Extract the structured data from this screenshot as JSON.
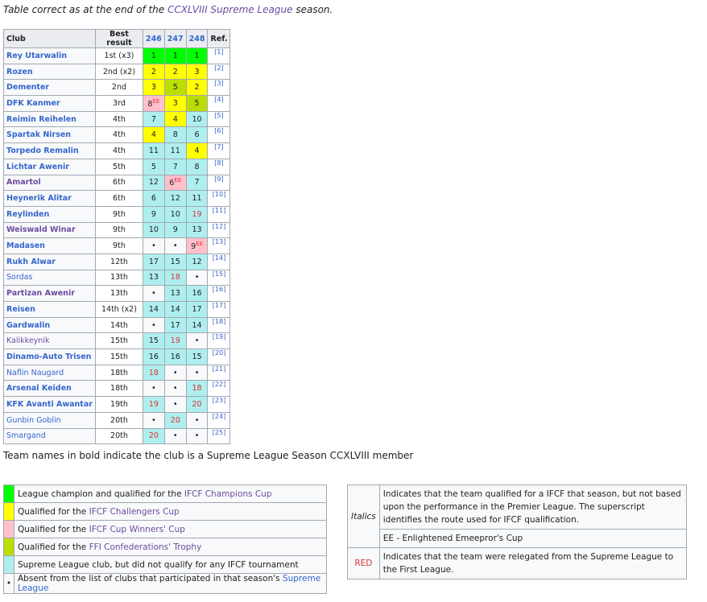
{
  "intro": {
    "before": "Table correct as at the end of the ",
    "link": "CCXLVIII Supreme League",
    "after": " season."
  },
  "headers": {
    "club": "Club",
    "best": "Best result",
    "y1": "246",
    "y2": "247",
    "y3": "248",
    "ref": "Ref."
  },
  "rows": [
    {
      "club": "Rey Utarwalin",
      "best": "1st (x3)",
      "r": [
        "1",
        "1",
        "1"
      ],
      "ref": "[1]"
    },
    {
      "club": "Rozen",
      "best": "2nd (x2)",
      "r": [
        "2",
        "2",
        "3"
      ],
      "ref": "[2]"
    },
    {
      "club": "Dementer",
      "best": "2nd",
      "r": [
        "3",
        "5",
        "2"
      ],
      "ref": "[3]"
    },
    {
      "club": "DFK Kanmer",
      "best": "3rd",
      "r": [
        "8",
        "3",
        "5"
      ],
      "r_sup": [
        "EE",
        "",
        ""
      ],
      "ref": "[4]"
    },
    {
      "club": "Reimin Reihelen",
      "best": "4th",
      "r": [
        "7",
        "4",
        "10"
      ],
      "ref": "[5]"
    },
    {
      "club": "Spartak Nirsen",
      "best": "4th",
      "r": [
        "4",
        "8",
        "6"
      ],
      "ref": "[6]"
    },
    {
      "club": "Torpedo Remalin",
      "best": "4th",
      "r": [
        "11",
        "11",
        "4"
      ],
      "ref": "[7]"
    },
    {
      "club": "Lichtar Awenir",
      "best": "5th",
      "r": [
        "5",
        "7",
        "8"
      ],
      "ref": "[8]"
    },
    {
      "club": "Amartol",
      "best": "6th",
      "r": [
        "12",
        "6",
        "7"
      ],
      "r_sup": [
        "",
        "EE",
        ""
      ],
      "ref": "[9]"
    },
    {
      "club": "Heynerik Alitar",
      "best": "6th",
      "r": [
        "6",
        "12",
        "11"
      ],
      "ref": "[10]"
    },
    {
      "club": "Reylinden",
      "best": "9th",
      "r": [
        "9",
        "10",
        "19"
      ],
      "ref": "[11]"
    },
    {
      "club": "Weiswald Winar",
      "best": "9th",
      "r": [
        "10",
        "9",
        "13"
      ],
      "ref": "[12]"
    },
    {
      "club": "Madasen",
      "best": "9th",
      "r": [
        "•",
        "•",
        "9"
      ],
      "r_sup": [
        "",
        "",
        "EE"
      ],
      "ref": "[13]"
    },
    {
      "club": "Rukh Alwar",
      "best": "12th",
      "r": [
        "17",
        "15",
        "12"
      ],
      "ref": "[14]"
    },
    {
      "club": "Sordas",
      "best": "13th",
      "r": [
        "13",
        "18",
        "•"
      ],
      "ref": "[15]"
    },
    {
      "club": "Partizan Awenir",
      "best": "13th",
      "r": [
        "•",
        "13",
        "16"
      ],
      "ref": "[16]"
    },
    {
      "club": "Reisen",
      "best": "14th (x2)",
      "r": [
        "14",
        "14",
        "17"
      ],
      "ref": "[17]"
    },
    {
      "club": "Gardwalin",
      "best": "14th",
      "r": [
        "•",
        "17",
        "14"
      ],
      "ref": "[18]"
    },
    {
      "club": "Kalikkeynik",
      "best": "15th",
      "r": [
        "15",
        "19",
        "•"
      ],
      "ref": "[19]"
    },
    {
      "club": "Dinamo-Auto Trisen",
      "best": "15th",
      "r": [
        "16",
        "16",
        "15"
      ],
      "ref": "[20]"
    },
    {
      "club": "Naflin Naugard",
      "best": "18th",
      "r": [
        "18",
        "•",
        "•"
      ],
      "ref": "[21]"
    },
    {
      "club": "Arsenal Keiden",
      "best": "18th",
      "r": [
        "•",
        "•",
        "18"
      ],
      "ref": "[22]"
    },
    {
      "club": "KFK Avanti Awantar",
      "best": "19th",
      "r": [
        "19",
        "•",
        "20"
      ],
      "ref": "[23]"
    },
    {
      "club": "Gunbin Goblin",
      "best": "20th",
      "r": [
        "•",
        "20",
        "•"
      ],
      "ref": "[24]"
    },
    {
      "club": "Smargand",
      "best": "20th",
      "r": [
        "20",
        "•",
        "•"
      ],
      "ref": "[25]"
    }
  ],
  "note": "Team names in bold indicate the club is a Supreme League Season CCXLVIII member",
  "legend": {
    "champion_before": "League champion and qualified for the ",
    "champion_link": "IFCF Champions Cup",
    "challengers_before": "Qualified for the ",
    "challengers_link": "IFCF Challengers Cup",
    "winners_before": "Qualified for the ",
    "winners_link": "IFCF Cup Winners' Cup",
    "confed_before": "Qualified for the ",
    "confed_link": "FFI Confederations' Trophy",
    "club": "Supreme League club, but did not qualify for any IFCF tournament",
    "absent_symbol": "•",
    "absent_before": "Absent from the list of clubs that participated in that season's ",
    "absent_link": "Supreme League"
  },
  "legend2": {
    "italics_key": "Italics",
    "italics_text": "Indicates that the team qualified for a IFCF that season, but not based upon the performance in the Premier League. The superscript identifies the route used for IFCF qualification.",
    "ee_text": "EE - Enlightened Emeepror's Cup",
    "red_key": "RED",
    "red_text": "Indicates that the team were relegated from the Supreme League to the First League."
  },
  "colors": {
    "green": "#00ff00",
    "yellow": "#ffff00",
    "pink": "#ffc0cb",
    "lime": "#bbdd00",
    "turquoise": "#afeeee",
    "link": "#3366cc",
    "visited": "#6b4ba1",
    "red": "#dd3333"
  }
}
